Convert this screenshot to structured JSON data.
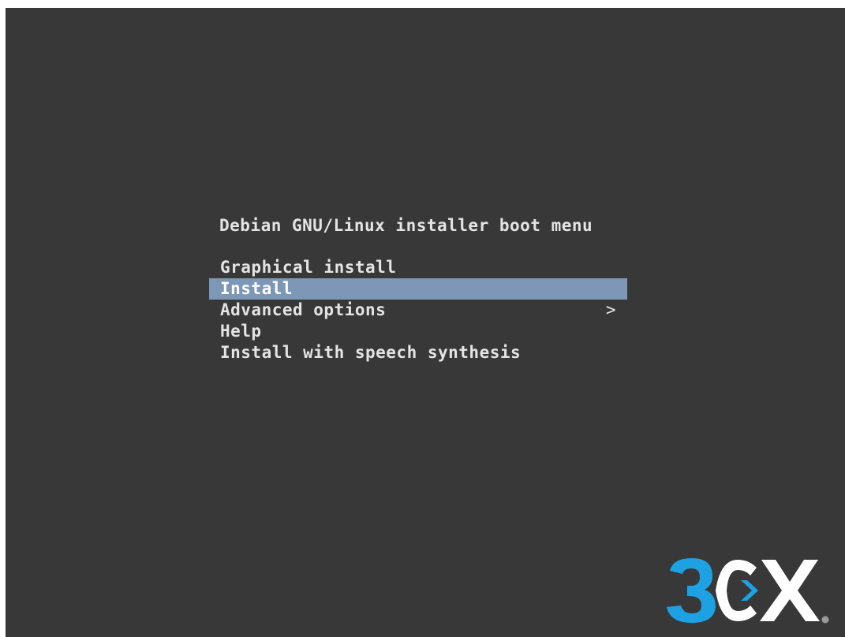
{
  "boot_menu": {
    "title": "Debian GNU/Linux installer boot menu",
    "items": [
      {
        "label": "Graphical install",
        "selected": false,
        "has_submenu": false
      },
      {
        "label": "Install",
        "selected": true,
        "has_submenu": false
      },
      {
        "label": "Advanced options",
        "selected": false,
        "has_submenu": true,
        "submenu_indicator": ">"
      },
      {
        "label": "Help",
        "selected": false,
        "has_submenu": false
      },
      {
        "label": "Install with speech synthesis",
        "selected": false,
        "has_submenu": false
      }
    ]
  },
  "logo": {
    "brand": "3CX",
    "registered_mark": "®",
    "icon": "3cx-logo",
    "colors": {
      "three": "#1da1e2",
      "letters": "#ffffff",
      "arrow": "#1da1e2"
    }
  },
  "colors": {
    "screen_background": "#383838",
    "menu_text": "#e4e4e4",
    "selection_highlight": "#7d98b6"
  }
}
